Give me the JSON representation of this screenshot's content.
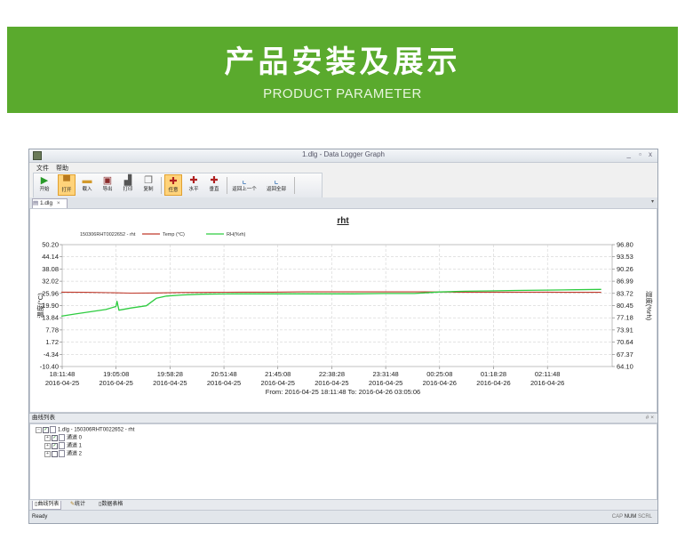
{
  "banner": {
    "title": "产品安装及展示",
    "subtitle": "PRODUCT PARAMETER"
  },
  "window": {
    "title": "1.dlg - Data Logger Graph",
    "controls": [
      "_",
      "▫",
      "x"
    ]
  },
  "menu": [
    "文件",
    "帮助"
  ],
  "toolbar": {
    "start": "开始",
    "open": "打开",
    "import": "载入",
    "export": "导出",
    "print": "打印",
    "copy": "复制",
    "pan": "任意",
    "horizontal": "水平",
    "vertical": "垂直",
    "back": "返回上一个",
    "home": "返回全部"
  },
  "tab": {
    "label": "1.dlg",
    "close": "×",
    "arrow": "▾"
  },
  "chart_data": {
    "type": "line",
    "title": "rht",
    "legend": [
      "150306RHT0022652 - rht",
      "Temp (°C)",
      "RH(%rh)"
    ],
    "legend_placement": "top-left",
    "ylabel_left": "温度(°C)",
    "ylabel_right": "湿度(%rh)",
    "y_left_ticks": [
      "50.20",
      "44.14",
      "38.08",
      "32.02",
      "25.96",
      "19.90",
      "13.84",
      "7.78",
      "1.72",
      "-4.34",
      "-10.40"
    ],
    "y_right_ticks": [
      "96.80",
      "93.53",
      "90.26",
      "86.99",
      "83.72",
      "80.45",
      "77.18",
      "73.91",
      "70.64",
      "67.37",
      "64.10"
    ],
    "ylim_left": [
      -10.4,
      50.2
    ],
    "ylim_right": [
      64.1,
      96.8
    ],
    "x_ticks": [
      {
        "time": "18:11:48",
        "date": "2016-04-25"
      },
      {
        "time": "19:05:08",
        "date": "2016-04-25"
      },
      {
        "time": "19:58:28",
        "date": "2016-04-25"
      },
      {
        "time": "20:51:48",
        "date": "2016-04-25"
      },
      {
        "time": "21:45:08",
        "date": "2016-04-25"
      },
      {
        "time": "22:38:28",
        "date": "2016-04-25"
      },
      {
        "time": "23:31:48",
        "date": "2016-04-25"
      },
      {
        "time": "00:25:08",
        "date": "2016-04-26"
      },
      {
        "time": "01:18:28",
        "date": "2016-04-26"
      },
      {
        "time": "02:11:48",
        "date": "2016-04-26"
      }
    ],
    "range_text": "From: 2016-04-25 18:11:48   To: 2016-04-26 03:05:06",
    "grid": true,
    "series": [
      {
        "name": "Temp (°C)",
        "axis": "left",
        "color": "#c0392b",
        "x": [
          "18:11",
          "18:35",
          "19:00",
          "19:20",
          "19:45",
          "20:10",
          "20:40",
          "21:10",
          "21:40",
          "22:10",
          "22:40",
          "23:10",
          "23:40",
          "00:10",
          "00:40",
          "01:10",
          "01:40",
          "02:10",
          "02:40",
          "03:05"
        ],
        "y": [
          26.6,
          26.5,
          26.3,
          26.1,
          26.2,
          26.4,
          26.5,
          26.6,
          26.6,
          26.7,
          26.7,
          26.7,
          26.7,
          26.7,
          26.6,
          26.6,
          26.6,
          26.6,
          26.5,
          26.5
        ]
      },
      {
        "name": "RH(%rh)",
        "axis": "right",
        "color": "#2ecc40",
        "x": [
          "18:11",
          "18:25",
          "18:40",
          "18:55",
          "19:05",
          "19:06",
          "19:08",
          "19:20",
          "19:35",
          "19:45",
          "19:55",
          "20:10",
          "20:30",
          "21:00",
          "21:30",
          "22:00",
          "22:30",
          "23:00",
          "23:30",
          "00:00",
          "00:25",
          "00:50",
          "01:15",
          "01:40",
          "02:10",
          "02:40",
          "03:05"
        ],
        "y": [
          77.6,
          78.2,
          78.8,
          79.4,
          80.2,
          81.6,
          79.2,
          79.8,
          80.4,
          82.4,
          83.0,
          83.3,
          83.5,
          83.6,
          83.6,
          83.6,
          83.6,
          83.6,
          83.7,
          83.7,
          84.1,
          84.3,
          84.4,
          84.5,
          84.6,
          84.7,
          84.8
        ]
      }
    ]
  },
  "panel": {
    "title": "曲线列表",
    "controls": "# ×"
  },
  "tree": {
    "root": "1.dlg - 150306RHT0022652 - rht",
    "children": [
      "通道 0",
      "通道 1",
      "通道 2"
    ]
  },
  "bottom_tabs": [
    "曲线列表",
    "统计",
    "数据表格"
  ],
  "status": {
    "left": "Ready",
    "caps": "CAP",
    "num": "NUM",
    "scrl": "SCRL"
  },
  "colors": {
    "banner": "#5aaa2d",
    "temp": "#c0392b",
    "rh": "#2ecc40"
  }
}
